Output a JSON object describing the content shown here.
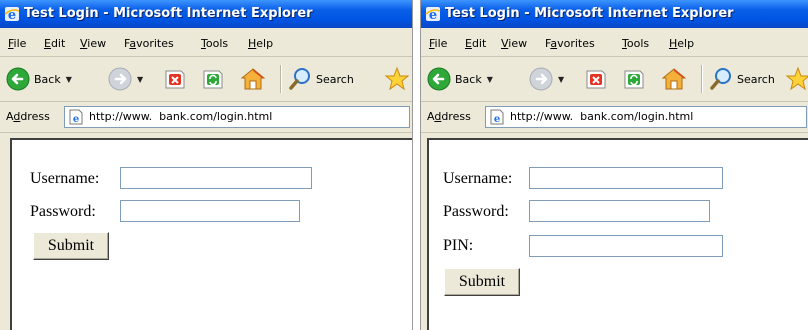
{
  "left_window": {
    "title": "Test Login - Microsoft Internet Explorer",
    "menu": {
      "file": {
        "key": "F",
        "rest": "ile"
      },
      "edit": {
        "key": "E",
        "rest": "dit"
      },
      "view": {
        "key": "V",
        "rest": "iew"
      },
      "favorites": {
        "pre": "F",
        "key": "a",
        "rest": "vorites"
      },
      "tools": {
        "key": "T",
        "rest": "ools"
      },
      "help": {
        "key": "H",
        "rest": "elp"
      }
    },
    "toolbar": {
      "back_label": "Back",
      "search_label": "Search"
    },
    "address": {
      "label_pre": "A",
      "label_key": "d",
      "label_rest": "dress",
      "url": "http://www.  bank.com/login.html"
    },
    "form": {
      "username_label": "Username:",
      "password_label": "Password:",
      "submit_label": "Submit"
    }
  },
  "right_window": {
    "title": "Test Login - Microsoft Internet Explorer",
    "menu": {
      "file": {
        "key": "F",
        "rest": "ile"
      },
      "edit": {
        "key": "E",
        "rest": "dit"
      },
      "view": {
        "key": "V",
        "rest": "iew"
      },
      "favorites": {
        "pre": "F",
        "key": "a",
        "rest": "vorites"
      },
      "tools": {
        "key": "T",
        "rest": "ools"
      },
      "help": {
        "key": "H",
        "rest": "elp"
      }
    },
    "toolbar": {
      "back_label": "Back",
      "search_label": "Search"
    },
    "address": {
      "label_pre": "A",
      "label_key": "d",
      "label_rest": "dress",
      "url": "http://www.  bank.com/login.html"
    },
    "form": {
      "username_label": "Username:",
      "password_label": "Password:",
      "pin_label": "PIN:",
      "submit_label": "Submit"
    }
  },
  "icons": [
    "ie-icon",
    "back-icon",
    "forward-icon",
    "stop-icon",
    "refresh-icon",
    "home-icon",
    "search-icon",
    "favorites-star-icon",
    "page-icon"
  ],
  "colors": {
    "titlebar": "#0054e3",
    "chrome": "#ece9d8",
    "field_border": "#7f9db9"
  }
}
